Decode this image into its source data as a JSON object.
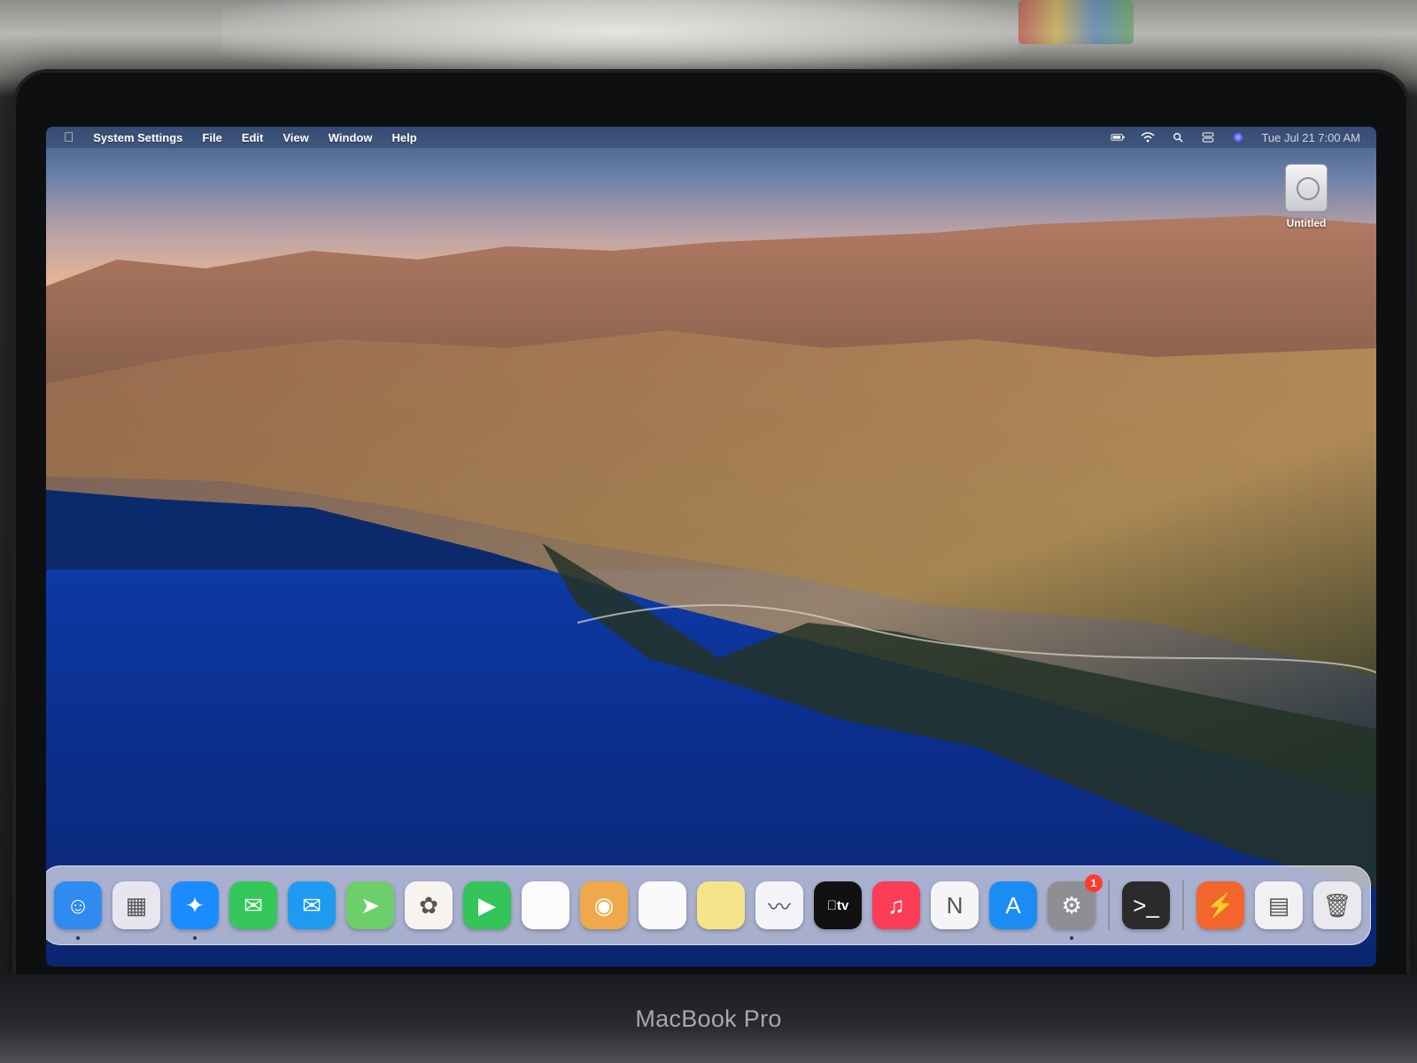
{
  "menu_bar": {
    "apple_icon": "apple-logo-icon",
    "app_name": "System Settings",
    "menus": [
      "File",
      "Edit",
      "View",
      "Window",
      "Help"
    ],
    "status_icons": [
      "battery-icon",
      "wifi-icon",
      "spotlight-search-icon",
      "control-center-icon",
      "siri-icon"
    ],
    "clock": "Tue Jul 21  7:00 AM"
  },
  "desktop": {
    "drive_label": "Untitled",
    "drive_icon": "external-disk-icon"
  },
  "dock": {
    "apps": [
      {
        "name": "Finder",
        "icon": "finder-icon",
        "glyph": "☺",
        "color": "#2f8bf0",
        "running": true
      },
      {
        "name": "Launchpad",
        "icon": "launchpad-icon",
        "glyph": "▦",
        "color": "#e7e6ef",
        "running": false
      },
      {
        "name": "Safari",
        "icon": "safari-icon",
        "glyph": "✦",
        "color": "#1a8cff",
        "running": true
      },
      {
        "name": "Messages",
        "icon": "messages-icon",
        "glyph": "✉",
        "color": "#34c759",
        "running": false
      },
      {
        "name": "Mail",
        "icon": "mail-icon",
        "glyph": "✉",
        "color": "#1e9bf0",
        "running": false
      },
      {
        "name": "Maps",
        "icon": "maps-icon",
        "glyph": "➤",
        "color": "#6ccf6a",
        "running": false
      },
      {
        "name": "Photos",
        "icon": "photos-icon",
        "glyph": "✿",
        "color": "#f7f4f0",
        "running": false
      },
      {
        "name": "FaceTime",
        "icon": "facetime-icon",
        "glyph": "▶",
        "color": "#33c45a",
        "running": false
      },
      {
        "name": "Calendar",
        "icon": "calendar-icon",
        "glyph": "",
        "color": "#fbfbfb",
        "running": false
      },
      {
        "name": "Contacts",
        "icon": "contacts-icon",
        "glyph": "◉",
        "color": "#f0a94a",
        "running": false
      },
      {
        "name": "Reminders",
        "icon": "reminders-icon",
        "glyph": "",
        "color": "#fafafa",
        "running": false
      },
      {
        "name": "Notes",
        "icon": "notes-icon",
        "glyph": "",
        "color": "#f6e48a",
        "running": false
      },
      {
        "name": "Freeform",
        "icon": "freeform-icon",
        "glyph": "〰",
        "color": "#f4f4f8",
        "running": false
      },
      {
        "name": "TV",
        "icon": "apple-tv-icon",
        "glyph": "tv",
        "color": "#111111",
        "running": false
      },
      {
        "name": "Music",
        "icon": "music-icon",
        "glyph": "♫",
        "color": "#fb3d57",
        "running": false
      },
      {
        "name": "News",
        "icon": "news-icon",
        "glyph": "N",
        "color": "#f5f5f7",
        "running": false
      },
      {
        "name": "App Store",
        "icon": "app-store-icon",
        "glyph": "A",
        "color": "#1c8cf5",
        "running": false
      },
      {
        "name": "System Settings",
        "icon": "system-settings-icon",
        "glyph": "⚙",
        "color": "#8e8e93",
        "running": true,
        "badge": "1"
      }
    ],
    "recent_apps": [
      {
        "name": "Terminal",
        "icon": "terminal-icon",
        "glyph": ">_",
        "color": "#2b2b2b",
        "running": false
      }
    ],
    "pinned_items": [
      {
        "name": "Shortcut App",
        "icon": "spark-app-icon",
        "glyph": "⚡",
        "color": "#f2652d",
        "running": false
      },
      {
        "name": "Downloads Stack",
        "icon": "downloads-stack-icon",
        "glyph": "▤",
        "color": "#f1f1f1",
        "running": false
      },
      {
        "name": "Trash",
        "icon": "trash-icon",
        "glyph": "🗑",
        "color": "#e9e9ee",
        "running": false
      }
    ]
  },
  "hardware": {
    "brand_label": "MacBook Pro"
  }
}
